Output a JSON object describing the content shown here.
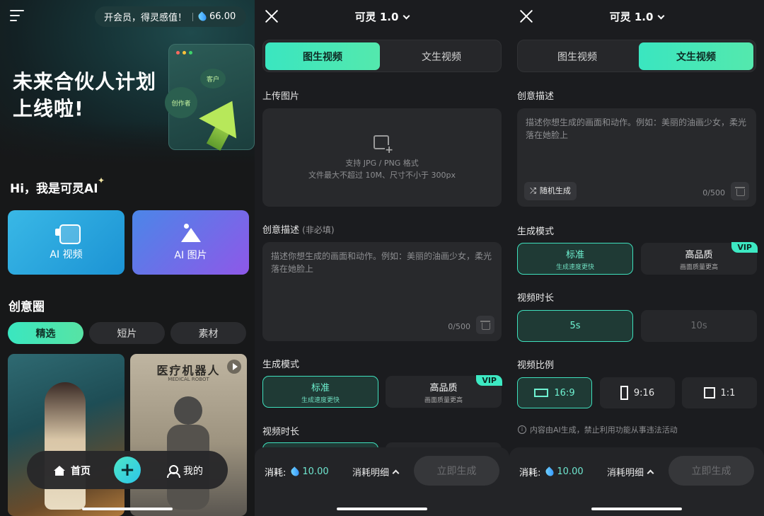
{
  "home": {
    "promo_text": "开会员，得灵感值！",
    "credits": "66.00",
    "hero_line1": "未来合伙人计划",
    "hero_line2": "上线啦!",
    "hero_bubble_customer": "客户",
    "hero_bubble_creator": "创作者",
    "greeting": "Hi，我是可灵AI",
    "card_video": "AI 视频",
    "card_image": "AI 图片",
    "section_title": "创意圈",
    "chips": [
      "精选",
      "短片",
      "素材"
    ],
    "thumb2_title": "医疗机器人",
    "thumb2_subtitle": "MEDICAL ROBOT",
    "nav_home": "首页",
    "nav_plus": "+",
    "nav_me": "我的"
  },
  "img2video": {
    "title": "可灵 1.0",
    "tabs": [
      "图生视频",
      "文生视频"
    ],
    "upload_label": "上传图片",
    "upload_hint1": "支持 JPG / PNG 格式",
    "upload_hint2": "文件最大不超过 10M、尺寸不小于 300px",
    "desc_label": "创意描述",
    "desc_optional": "(非必填)",
    "desc_placeholder": "描述你想生成的画面和动作。例如：美丽的油画少女，柔光落在她脸上",
    "desc_count": "0/500",
    "mode_label": "生成模式",
    "mode_standard": "标准",
    "mode_standard_sub": "生成速度更快",
    "mode_high": "高品质",
    "mode_high_sub": "画面质量更高",
    "vip": "VIP",
    "duration_label": "视频时长",
    "cost_label": "消耗:",
    "cost_value": "10.00",
    "cost_detail": "消耗明细",
    "generate": "立即生成"
  },
  "text2video": {
    "title": "可灵 1.0",
    "tabs": [
      "图生视频",
      "文生视频"
    ],
    "desc_label": "创意描述",
    "desc_placeholder": "描述你想生成的画面和动作。例如：美丽的油画少女，柔光落在她脸上",
    "random": "随机生成",
    "desc_count": "0/500",
    "mode_label": "生成模式",
    "mode_standard": "标准",
    "mode_standard_sub": "生成速度更快",
    "mode_high": "高品质",
    "mode_high_sub": "画面质量更高",
    "vip": "VIP",
    "duration_label": "视频时长",
    "durations": [
      "5s",
      "10s"
    ],
    "ratio_label": "视频比例",
    "ratios": [
      "16:9",
      "9:16",
      "1:1"
    ],
    "notice": "内容由AI生成，禁止利用功能从事违法活动",
    "cost_label": "消耗:",
    "cost_value": "10.00",
    "cost_detail": "消耗明细",
    "generate": "立即生成"
  },
  "colors": {
    "accent": "#3ae6c0",
    "background": "#1b1c1f"
  }
}
